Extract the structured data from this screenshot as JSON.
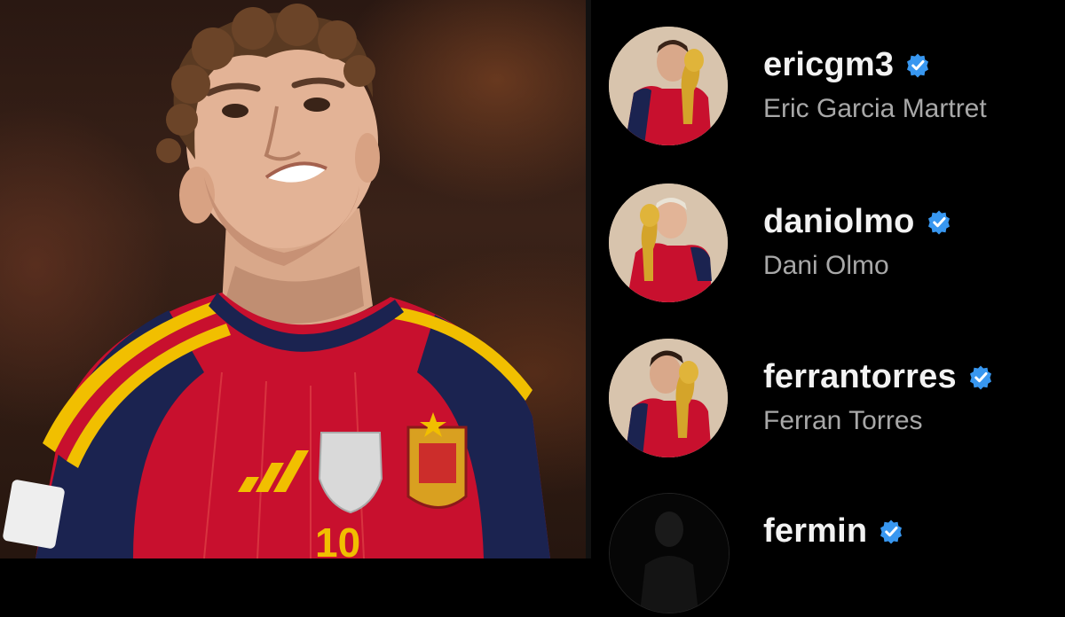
{
  "accounts": [
    {
      "username": "ericgm3",
      "full_name": "Eric Garcia Martret",
      "verified": true,
      "avatar": "player-with-world-cup-trophy"
    },
    {
      "username": "daniolmo",
      "full_name": "Dani Olmo",
      "verified": true,
      "avatar": "player-with-world-cup-trophy"
    },
    {
      "username": "ferrantorres",
      "full_name": "Ferran Torres",
      "verified": true,
      "avatar": "player-with-world-cup-trophy"
    },
    {
      "username": "fermin",
      "full_name": "",
      "verified": true,
      "avatar": "dark-profile-photo"
    }
  ],
  "colors": {
    "background": "#000000",
    "username": "#f2f2f2",
    "full_name": "#a8a8a8",
    "verified_badge": "#3897f0",
    "jersey_red": "#c8102e",
    "jersey_navy": "#1b2350",
    "jersey_yellow": "#f1bf00"
  }
}
